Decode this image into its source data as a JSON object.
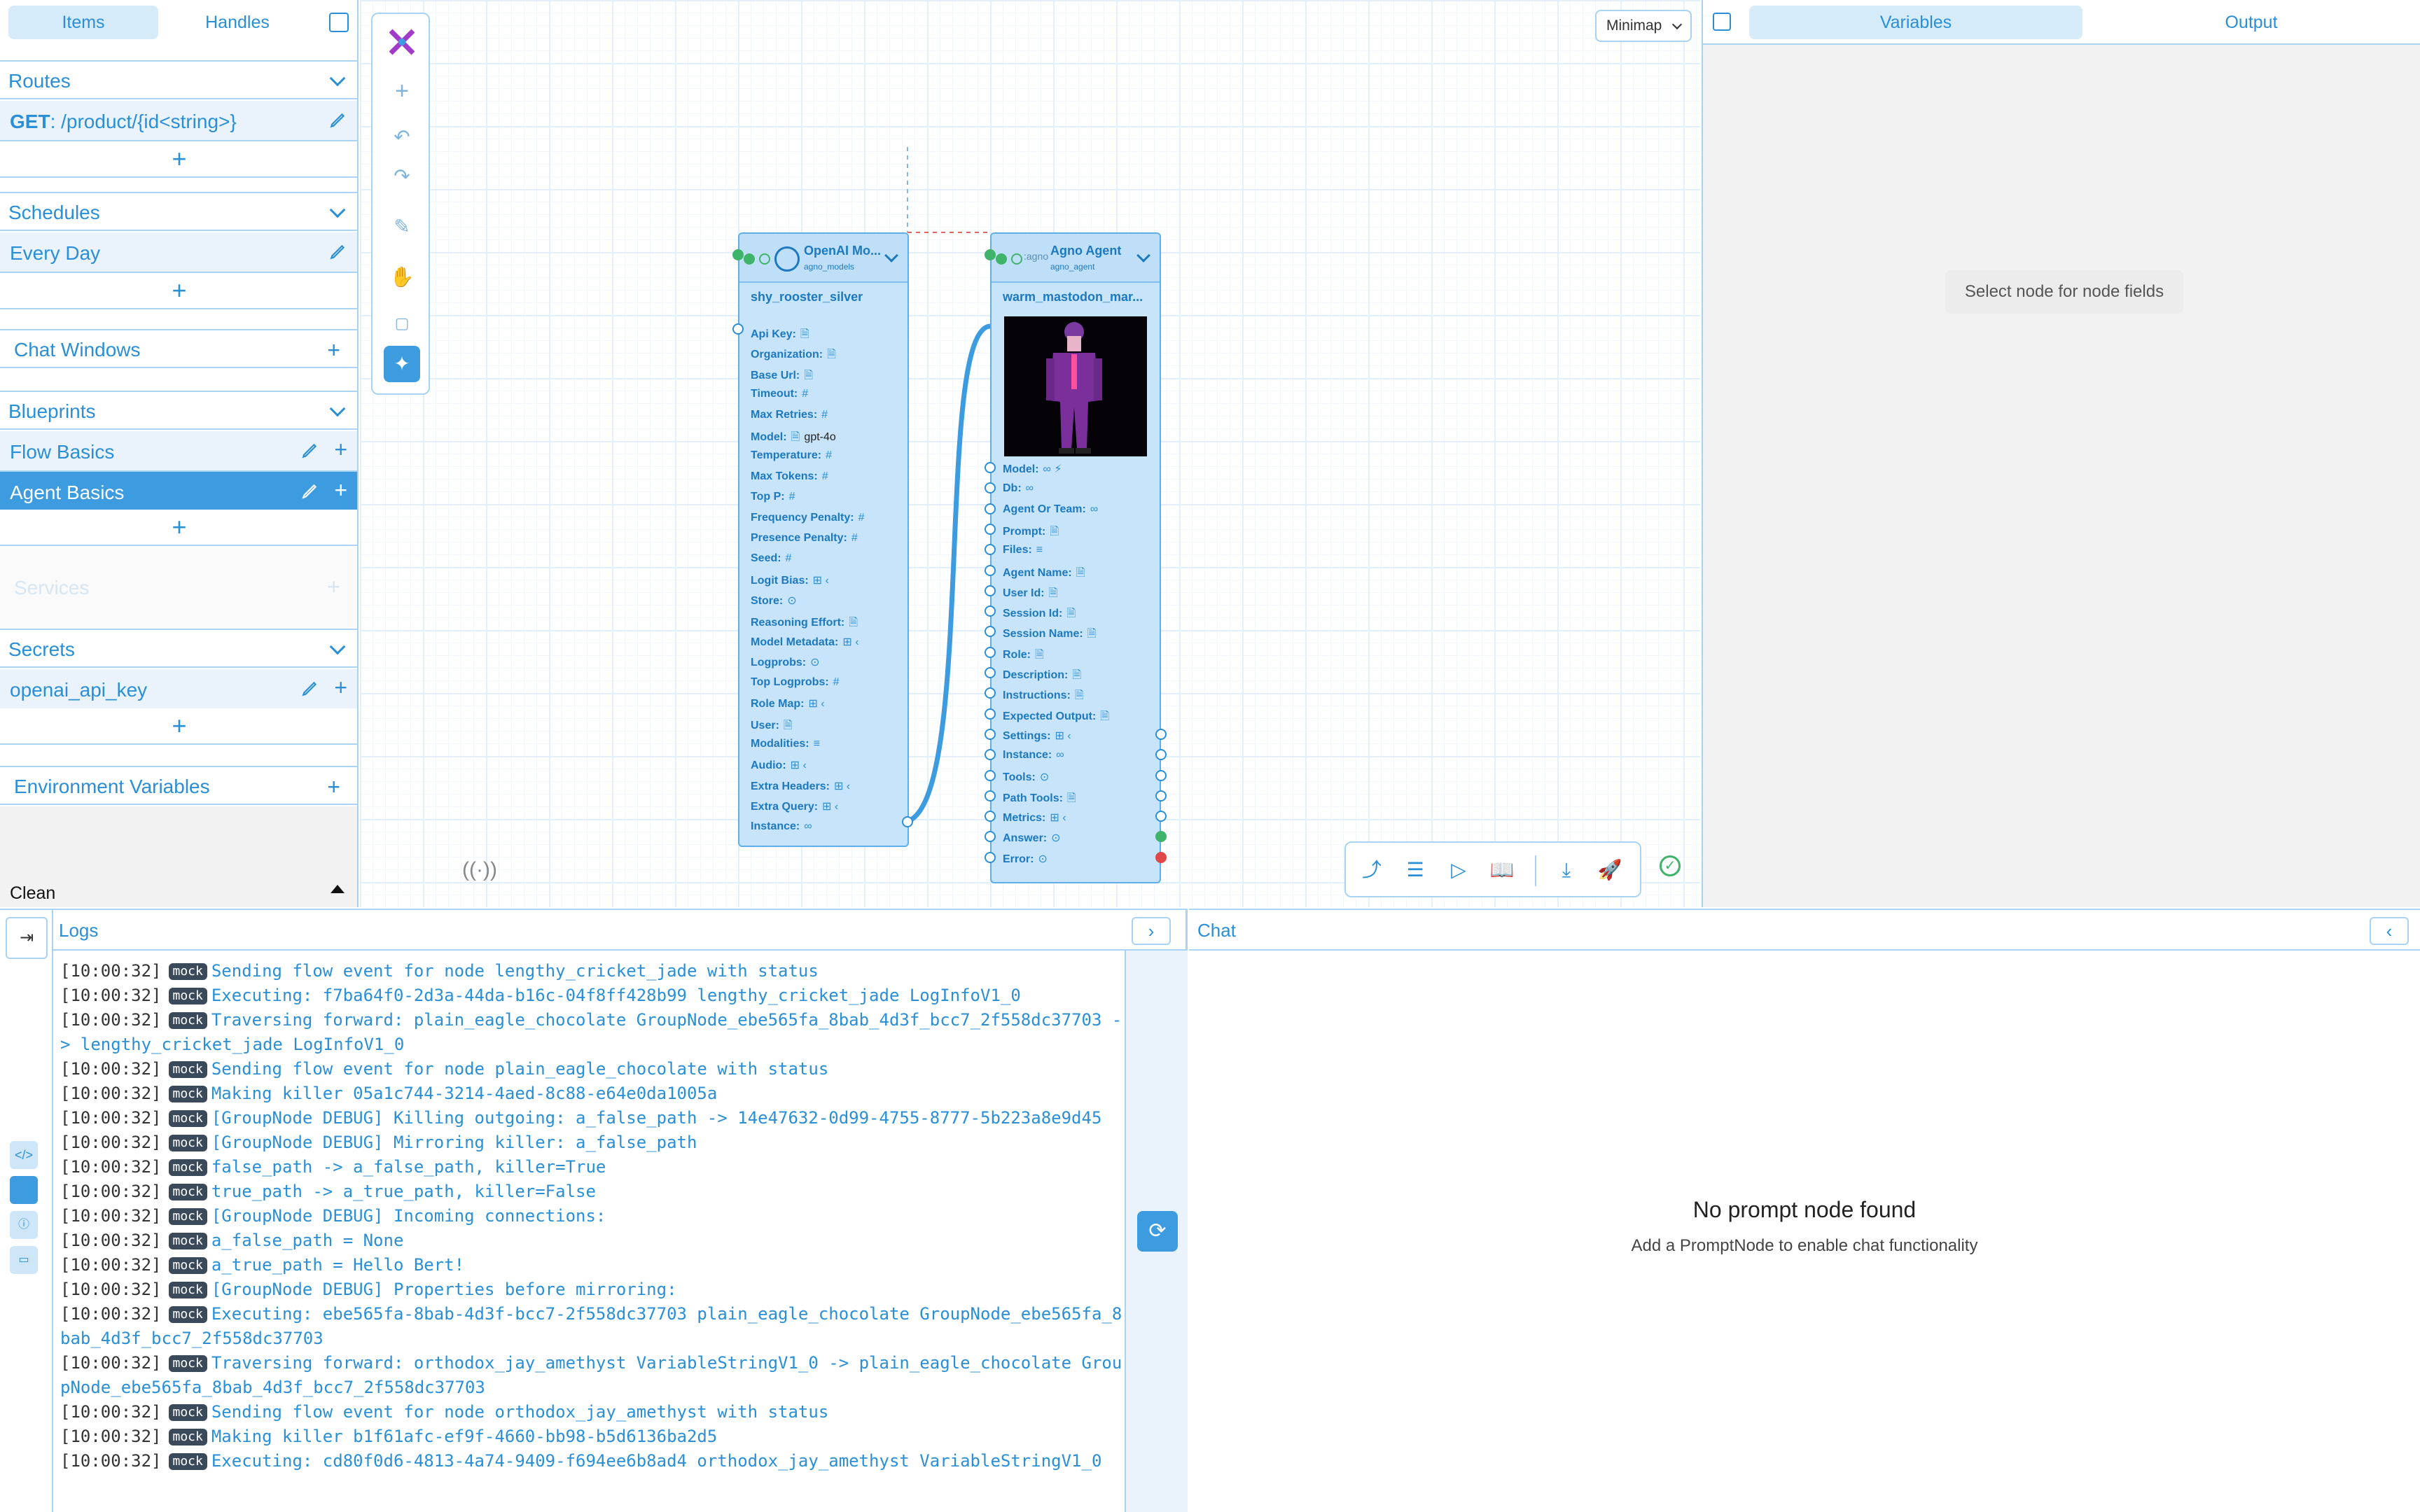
{
  "sidebar": {
    "tabs": [
      "Items",
      "Handles"
    ],
    "routes": {
      "title": "Routes",
      "item_method": "GET",
      "item_path": ": /product/{id<string>}"
    },
    "schedules": {
      "title": "Schedules",
      "item": "Every Day"
    },
    "chat_windows": {
      "title": "Chat Windows"
    },
    "blueprints": {
      "title": "Blueprints",
      "items": [
        "Flow Basics",
        "Agent Basics"
      ]
    },
    "services": {
      "title": "Services"
    },
    "secrets": {
      "title": "Secrets",
      "item": "openai_api_key"
    },
    "env": {
      "title": "Environment Variables"
    },
    "footer": "Clean"
  },
  "canvas": {
    "minimap_label": "Minimap",
    "node_openai": {
      "title": "OpenAI Mo...",
      "subtitle": "agno_models",
      "name": "shy_rooster_silver",
      "fields": [
        {
          "label": "Api Key:",
          "icon": "🗎"
        },
        {
          "label": "Organization:",
          "icon": "🗎"
        },
        {
          "label": "Base Url:",
          "icon": "🗎"
        },
        {
          "label": "Timeout:",
          "icon": "#"
        },
        {
          "label": "Max Retries:",
          "icon": "#"
        },
        {
          "label": "Model:",
          "icon": "🗎",
          "value": "gpt-4o"
        },
        {
          "label": "Temperature:",
          "icon": "#"
        },
        {
          "label": "Max Tokens:",
          "icon": "#"
        },
        {
          "label": "Top P:",
          "icon": "#"
        },
        {
          "label": "Frequency Penalty:",
          "icon": "#"
        },
        {
          "label": "Presence Penalty:",
          "icon": "#"
        },
        {
          "label": "Seed:",
          "icon": "#"
        },
        {
          "label": "Logit Bias:",
          "icon": "⊞  ‹"
        },
        {
          "label": "Store:",
          "icon": "⊙"
        },
        {
          "label": "Reasoning Effort:",
          "icon": "🗎"
        },
        {
          "label": "Model Metadata:",
          "icon": "⊞  ‹"
        },
        {
          "label": "Logprobs:",
          "icon": "⊙"
        },
        {
          "label": "Top Logprobs:",
          "icon": "#"
        },
        {
          "label": "Role Map:",
          "icon": "⊞  ‹"
        },
        {
          "label": "User:",
          "icon": "🗎"
        },
        {
          "label": "Modalities:",
          "icon": "≡"
        },
        {
          "label": "Audio:",
          "icon": "⊞  ‹"
        },
        {
          "label": "Extra Headers:",
          "icon": "⊞  ‹"
        },
        {
          "label": "Extra Query:",
          "icon": "⊞  ‹"
        },
        {
          "label": "Instance:",
          "icon": "∞"
        }
      ]
    },
    "node_agent": {
      "title": "Agno Agent",
      "subtitle": "agno_agent",
      "name": "warm_mastodon_mar...",
      "logo": ":agno",
      "fields": [
        {
          "label": "Model:",
          "icon": "∞ ⚡"
        },
        {
          "label": "Db:",
          "icon": "∞"
        },
        {
          "label": "Agent Or Team:",
          "icon": "∞"
        },
        {
          "label": "Prompt:",
          "icon": "🗎"
        },
        {
          "label": "Files:",
          "icon": "≡"
        },
        {
          "label": "Agent Name:",
          "icon": "🗎"
        },
        {
          "label": "User Id:",
          "icon": "🗎"
        },
        {
          "label": "Session Id:",
          "icon": "🗎"
        },
        {
          "label": "Session Name:",
          "icon": "🗎"
        },
        {
          "label": "Role:",
          "icon": "🗎"
        },
        {
          "label": "Description:",
          "icon": "🗎"
        },
        {
          "label": "Instructions:",
          "icon": "🗎"
        },
        {
          "label": "Expected Output:",
          "icon": "🗎"
        },
        {
          "label": "Settings:",
          "icon": "⊞  ‹"
        },
        {
          "label": "Instance:",
          "icon": "∞"
        },
        {
          "label": "Tools:",
          "icon": "⊙"
        },
        {
          "label": "Path Tools:",
          "icon": "🗎"
        },
        {
          "label": "Metrics:",
          "icon": "⊞  ‹"
        },
        {
          "label": "Answer:",
          "icon": "⊙"
        },
        {
          "label": "Error:",
          "icon": "⊙"
        }
      ]
    }
  },
  "right": {
    "tabs": [
      "Variables",
      "Output"
    ],
    "hint": "Select node for node fields"
  },
  "logs": {
    "title": "Logs",
    "badge": "mock",
    "lines": [
      {
        "t": "[10:00:32]",
        "m": "Sending flow event for node lengthy_cricket_jade with status"
      },
      {
        "t": "[10:00:32]",
        "m": "Executing: f7ba64f0-2d3a-44da-b16c-04f8ff428b99 lengthy_cricket_jade LogInfoV1_0"
      },
      {
        "t": "[10:00:32]",
        "m": "Traversing forward: plain_eagle_chocolate GroupNode_ebe565fa_8bab_4d3f_bcc7_2f558dc37703 -> lengthy_cricket_jade LogInfoV1_0"
      },
      {
        "t": "[10:00:32]",
        "m": "Sending flow event for node plain_eagle_chocolate with status"
      },
      {
        "t": "[10:00:32]",
        "m": "Making killer 05a1c744-3214-4aed-8c88-e64e0da1005a"
      },
      {
        "t": "[10:00:32]",
        "m": "[GroupNode DEBUG] Killing outgoing: a_false_path -> 14e47632-0d99-4755-8777-5b223a8e9d45"
      },
      {
        "t": "[10:00:32]",
        "m": "[GroupNode DEBUG] Mirroring killer: a_false_path"
      },
      {
        "t": "[10:00:32]",
        "m": "false_path -> a_false_path, killer=True"
      },
      {
        "t": "[10:00:32]",
        "m": "true_path -> a_true_path, killer=False"
      },
      {
        "t": "[10:00:32]",
        "m": "[GroupNode DEBUG] Incoming connections:"
      },
      {
        "t": "[10:00:32]",
        "m": "a_false_path = None"
      },
      {
        "t": "[10:00:32]",
        "m": "a_true_path = Hello Bert!"
      },
      {
        "t": "[10:00:32]",
        "m": "[GroupNode DEBUG] Properties before mirroring:"
      },
      {
        "t": "[10:00:32]",
        "m": "Executing: ebe565fa-8bab-4d3f-bcc7-2f558dc37703 plain_eagle_chocolate GroupNode_ebe565fa_8bab_4d3f_bcc7_2f558dc37703"
      },
      {
        "t": "[10:00:32]",
        "m": "Traversing forward: orthodox_jay_amethyst VariableStringV1_0 -> plain_eagle_chocolate GroupNode_ebe565fa_8bab_4d3f_bcc7_2f558dc37703"
      },
      {
        "t": "[10:00:32]",
        "m": "Sending flow event for node orthodox_jay_amethyst with status"
      },
      {
        "t": "[10:00:32]",
        "m": "Making killer b1f61afc-ef9f-4660-bb98-b5d6136ba2d5"
      },
      {
        "t": "[10:00:32]",
        "m": "Executing: cd80f0d6-4813-4a74-9409-f694ee6b8ad4 orthodox_jay_amethyst VariableStringV1_0"
      }
    ]
  },
  "chat": {
    "title": "Chat",
    "empty_title": "No prompt node found",
    "empty_sub": "Add a PromptNode to enable chat functionality"
  },
  "colors": {
    "accent": "#2a8fd6",
    "selected": "#3d9be0",
    "node_fill": "#c7e4fa"
  }
}
